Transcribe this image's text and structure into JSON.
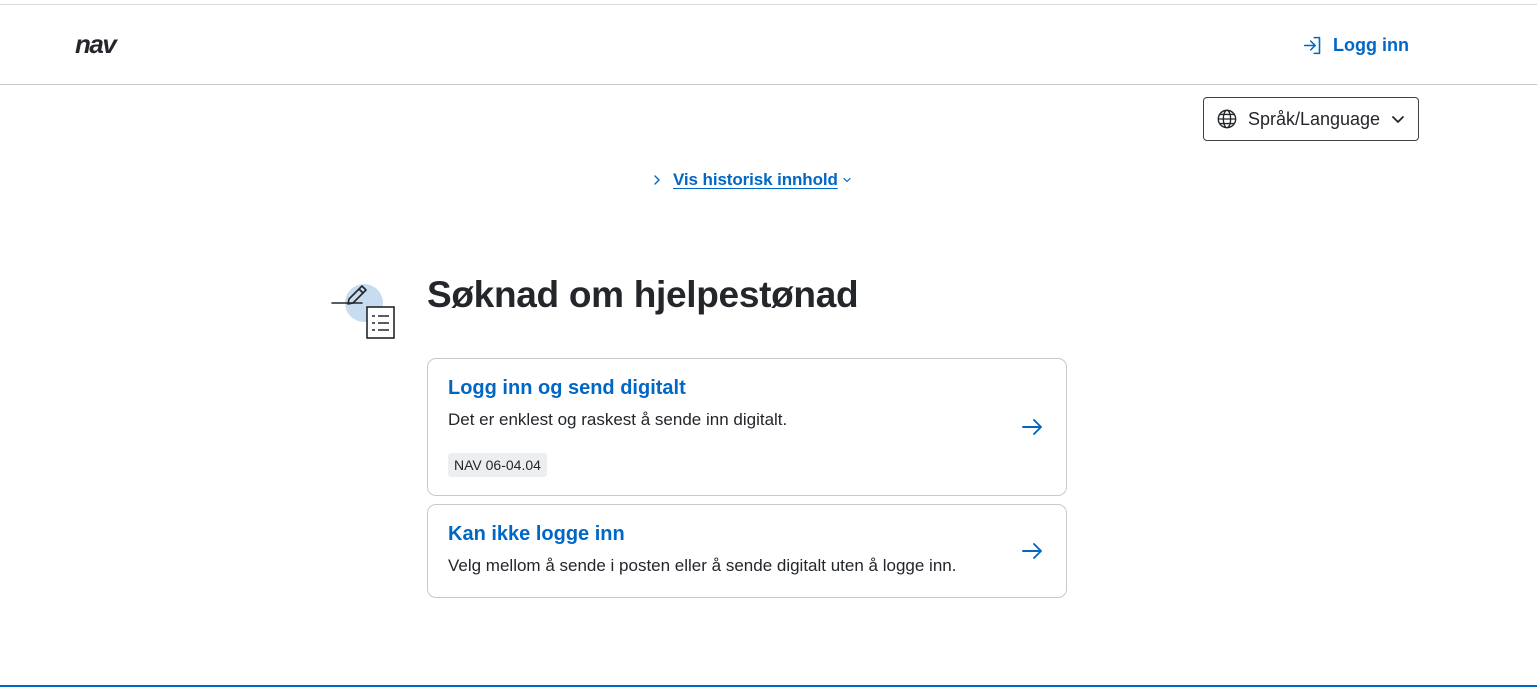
{
  "header": {
    "logo_text": "nav",
    "login_label": "Logg inn"
  },
  "language": {
    "label": "Språk/Language"
  },
  "history": {
    "label": "Vis historisk innhold"
  },
  "main": {
    "title": "Søknad om hjelpestønad",
    "cards": [
      {
        "title": "Logg inn og send digitalt",
        "description": "Det er enklest og raskest å sende inn digitalt.",
        "tag": "NAV 06-04.04"
      },
      {
        "title": "Kan ikke logge inn",
        "description": "Velg mellom å sende i posten eller å sende digitalt uten å logge inn."
      }
    ]
  },
  "colors": {
    "accent": "#0067c5",
    "text": "#23262a",
    "border": "#c6c9ce",
    "tag_bg": "#eceef0"
  },
  "icons": {
    "logo": "nav-logo",
    "login": "login-icon",
    "globe": "globe-icon",
    "dropdown": "chevron-down-icon",
    "expand": "chevron-right-icon",
    "illustration": "form-pencil-icon",
    "arrow": "arrow-right-icon"
  }
}
